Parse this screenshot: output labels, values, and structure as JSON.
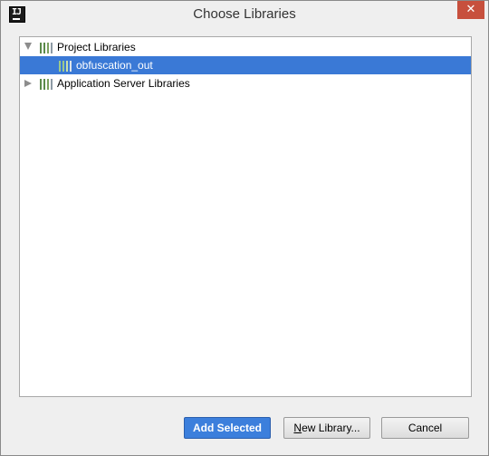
{
  "window": {
    "title": "Choose Libraries",
    "app_icon_text": "IJ",
    "close_glyph": "✕"
  },
  "tree": {
    "nodes": [
      {
        "label": "Project Libraries",
        "expanded": true,
        "icon": "library-icon"
      },
      {
        "label": "obfuscation_out",
        "selected": true,
        "icon": "library-icon"
      },
      {
        "label": "Application Server Libraries",
        "expanded": false,
        "icon": "library-icon"
      }
    ]
  },
  "buttons": {
    "add_selected": "Add Selected",
    "new_library_mnemonic": "N",
    "new_library_rest": "ew Library...",
    "cancel": "Cancel"
  },
  "colors": {
    "selection": "#3a79d6",
    "primary_button": "#3c7fdc",
    "close_button": "#c7503d"
  }
}
